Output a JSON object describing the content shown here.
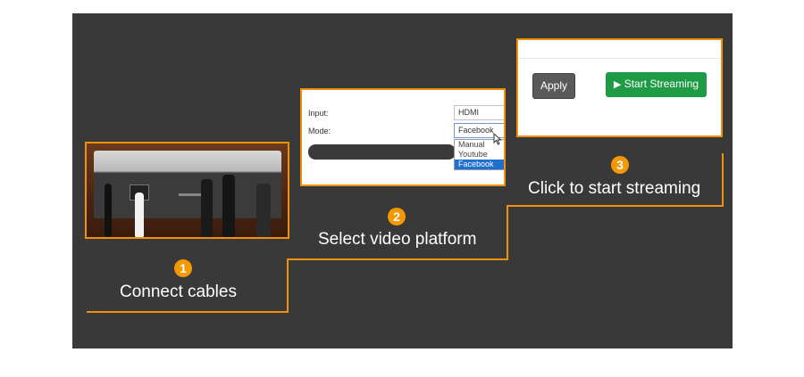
{
  "steps": [
    {
      "number": "1",
      "caption": "Connect cables"
    },
    {
      "number": "2",
      "caption": "Select video platform"
    },
    {
      "number": "3",
      "caption": "Click to start streaming"
    }
  ],
  "form": {
    "input_label": "Input:",
    "input_value": "HDMI",
    "mode_label": "Mode:",
    "mode_value": "Facebook",
    "options": [
      "Manual",
      "Youtube",
      "Facebook"
    ]
  },
  "buttons": {
    "apply_label": "Apply",
    "stream_label": "Start Streaming",
    "stream_icon": "play-icon"
  },
  "colors": {
    "accent": "#f0900c",
    "panel": "#3a3939",
    "stream_button": "#1f9a45",
    "selected_option": "#1e6fd0"
  }
}
